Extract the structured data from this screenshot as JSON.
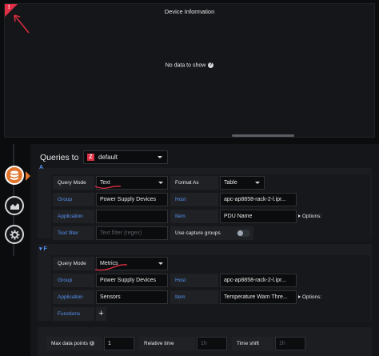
{
  "panel": {
    "title": "Device Information",
    "no_data": "No data to show",
    "corner_mark": "!",
    "accent": "#e02f44"
  },
  "sidebar": {
    "items": [
      {
        "icon": "database-icon",
        "active": true
      },
      {
        "icon": "chart-area-icon",
        "active": false
      },
      {
        "icon": "gear-icon",
        "active": false
      }
    ],
    "accent": "#e0752d"
  },
  "editor": {
    "queries_to": "Queries to",
    "datasource": {
      "logo": "Z",
      "name": "default"
    },
    "query_a": {
      "header": "A",
      "query_mode_label": "Query Mode",
      "query_mode_value": "Text",
      "format_as_label": "Format As",
      "format_as_value": "Table",
      "group_label": "Group",
      "group_value": "Power Supply Devices",
      "host_label": "Host",
      "host_value": "apc-ap8858-rack-2-l.ipr...",
      "application_label": "Application",
      "application_value": "",
      "item_label": "Item",
      "item_value": "PDU Name",
      "options_label": "Options:",
      "text_filter_label": "Text filter",
      "text_filter_placeholder": "Text filter (regex)",
      "capture_groups_label": "Use capture groups"
    },
    "query_f": {
      "header": "F",
      "query_mode_label": "Query Mode",
      "query_mode_value": "Metrics",
      "group_label": "Group",
      "group_value": "Power Supply Devices",
      "host_label": "Host",
      "host_value": "apc-ap8858-rack-2-l.ipr...",
      "application_label": "Application",
      "application_value": "Sensors",
      "item_label": "Item",
      "item_value": "Temperature Warn Thre...",
      "options_label": "Options:",
      "functions_label": "Functions",
      "add_label": "+"
    },
    "options_bar": {
      "max_data_points_label": "Max data points",
      "max_data_points_value": "1",
      "info_glyph": "i",
      "relative_time_label": "Relative time",
      "relative_time_placeholder": "1h",
      "time_shift_label": "Time shift",
      "time_shift_placeholder": "1h"
    }
  }
}
